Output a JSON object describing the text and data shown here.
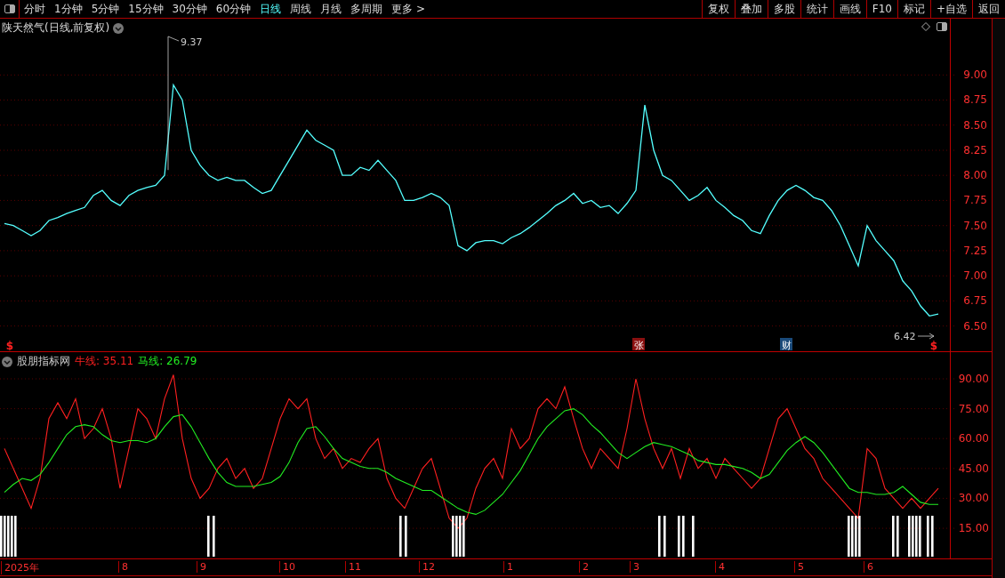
{
  "toolbar": {
    "periods": [
      {
        "label": "分时",
        "selected": false
      },
      {
        "label": "1分钟",
        "selected": false
      },
      {
        "label": "5分钟",
        "selected": false
      },
      {
        "label": "15分钟",
        "selected": false
      },
      {
        "label": "30分钟",
        "selected": false
      },
      {
        "label": "60分钟",
        "selected": false
      },
      {
        "label": "日线",
        "selected": true
      },
      {
        "label": "周线",
        "selected": false
      },
      {
        "label": "月线",
        "selected": false
      },
      {
        "label": "多周期",
        "selected": false
      },
      {
        "label": "更多 >",
        "selected": false
      }
    ],
    "actions": [
      "复权",
      "叠加",
      "多股",
      "统计",
      "画线",
      "F10",
      "标记",
      "+自选",
      "返回"
    ]
  },
  "price_panel": {
    "title": "陕天然气(日线,前复权)",
    "chart_data": {
      "type": "line",
      "grid": true,
      "categories": [
        null,
        null,
        null,
        null,
        null,
        null,
        null,
        null,
        null,
        null,
        null,
        null,
        null,
        null,
        null,
        null,
        null,
        null,
        null,
        null,
        null,
        null,
        null,
        null,
        null,
        null,
        null,
        null,
        null,
        null,
        null,
        null,
        null,
        null,
        null,
        null,
        null,
        null,
        null,
        null,
        null,
        null,
        null,
        null,
        null,
        null,
        null,
        null,
        null,
        null,
        null,
        null,
        null,
        null,
        null,
        null,
        null,
        null,
        null,
        null,
        null,
        null,
        null,
        null,
        null,
        null,
        null,
        null,
        null,
        null,
        null,
        null,
        null,
        null,
        null,
        null,
        null,
        null,
        null,
        null,
        null,
        null,
        null,
        null,
        null,
        null,
        null,
        null,
        null,
        null,
        null,
        null,
        null,
        null,
        null,
        null,
        null,
        null,
        null,
        null,
        null,
        null,
        null,
        null,
        null,
        null
      ],
      "ylim": [
        6.24,
        9.56
      ],
      "yticks": [
        {
          "value": 6.5,
          "label": "6.50"
        },
        {
          "value": 6.75,
          "label": "6.75"
        },
        {
          "value": 7,
          "label": "7.00"
        },
        {
          "value": 7.25,
          "label": "7.25"
        },
        {
          "value": 7.5,
          "label": "7.50"
        },
        {
          "value": 7.75,
          "label": "7.75"
        },
        {
          "value": 8,
          "label": "8.00"
        },
        {
          "value": 8.25,
          "label": "8.25"
        },
        {
          "value": 8.5,
          "label": "8.50"
        },
        {
          "value": 8.75,
          "label": "8.75"
        },
        {
          "value": 9,
          "label": "9.00"
        }
      ],
      "series": [
        {
          "color": "#54ffff",
          "values": [
            7.52,
            7.5,
            7.45,
            7.4,
            7.45,
            7.55,
            7.58,
            7.62,
            7.65,
            7.68,
            7.8,
            7.85,
            7.75,
            7.7,
            7.8,
            7.85,
            7.88,
            7.9,
            8.0,
            8.9,
            8.75,
            8.25,
            8.1,
            8.0,
            7.95,
            7.98,
            7.95,
            7.95,
            7.88,
            7.82,
            7.85,
            8.0,
            8.15,
            8.3,
            8.45,
            8.35,
            8.3,
            8.25,
            8.0,
            8.0,
            8.08,
            8.05,
            8.15,
            8.05,
            7.95,
            7.75,
            7.75,
            7.78,
            7.82,
            7.78,
            7.7,
            7.3,
            7.25,
            7.33,
            7.35,
            7.35,
            7.32,
            7.38,
            7.42,
            7.48,
            7.55,
            7.62,
            7.7,
            7.75,
            7.82,
            7.72,
            7.75,
            7.68,
            7.7,
            7.62,
            7.72,
            7.85,
            8.7,
            8.25,
            8.0,
            7.95,
            7.85,
            7.75,
            7.8,
            7.88,
            7.75,
            7.68,
            7.6,
            7.55,
            7.45,
            7.42,
            7.6,
            7.75,
            7.85,
            7.9,
            7.85,
            7.78,
            7.75,
            7.65,
            7.5,
            7.3,
            7.1,
            7.5,
            7.35,
            7.25,
            7.15,
            6.95,
            6.85,
            6.7,
            6.6,
            6.62
          ]
        }
      ]
    },
    "markers": [
      {
        "text": "9.37",
        "kind": "high"
      },
      {
        "text": "6.42",
        "kind": "low"
      },
      {
        "text": "$",
        "kind": "dollar"
      },
      {
        "text": "张",
        "kind": "red-tag"
      },
      {
        "text": "财",
        "kind": "blue-tag"
      },
      {
        "text": "$",
        "kind": "dollar"
      }
    ]
  },
  "indicator_panel": {
    "name": "股朋指标网",
    "readings": [
      ": 35.11",
      ": 26.79"
    ],
    "chart_data": {
      "type": "line",
      "grid": true,
      "categories": [
        null,
        null,
        null,
        null,
        null,
        null,
        null,
        null,
        null,
        null,
        null,
        null,
        null,
        null,
        null,
        null,
        null,
        null,
        null,
        null,
        null,
        null,
        null,
        null,
        null,
        null,
        null,
        null,
        null,
        null,
        null,
        null,
        null,
        null,
        null,
        null,
        null,
        null,
        null,
        null,
        null,
        null,
        null,
        null,
        null,
        null,
        null,
        null,
        null,
        null,
        null,
        null,
        null,
        null,
        null,
        null,
        null,
        null,
        null,
        null,
        null,
        null,
        null,
        null,
        null,
        null,
        null,
        null,
        null,
        null,
        null,
        null,
        null,
        null,
        null,
        null,
        null,
        null,
        null,
        null,
        null,
        null,
        null,
        null,
        null,
        null,
        null,
        null,
        null,
        null,
        null,
        null,
        null,
        null,
        null,
        null,
        null,
        null,
        null,
        null,
        null,
        null,
        null,
        null,
        null,
        null
      ],
      "ylim": [
        -0.6,
        103.4
      ],
      "yticks": [
        {
          "value": 15,
          "label": "15.00"
        },
        {
          "value": 30,
          "label": "30.00"
        },
        {
          "value": 45,
          "label": "45.00"
        },
        {
          "value": 60,
          "label": "60.00"
        },
        {
          "value": 75,
          "label": "75.00"
        },
        {
          "value": 90,
          "label": "90.00"
        }
      ],
      "series": [
        {
          "name": "牛线",
          "color": "#ff2020",
          "values": [
            55,
            45,
            35,
            25,
            40,
            70,
            78,
            70,
            80,
            60,
            65,
            75,
            60,
            35,
            55,
            75,
            70,
            60,
            80,
            92,
            60,
            40,
            30,
            35,
            45,
            50,
            40,
            45,
            35,
            40,
            55,
            70,
            80,
            75,
            80,
            60,
            50,
            55,
            45,
            50,
            48,
            55,
            60,
            40,
            30,
            25,
            35,
            45,
            50,
            35,
            20,
            15,
            20,
            35,
            45,
            50,
            40,
            65,
            55,
            60,
            75,
            80,
            75,
            86,
            70,
            55,
            45,
            55,
            50,
            45,
            65,
            90,
            70,
            55,
            45,
            55,
            40,
            55,
            45,
            50,
            40,
            50,
            45,
            40,
            35,
            40,
            55,
            70,
            75,
            65,
            55,
            50,
            40,
            35,
            30,
            25,
            20,
            55,
            50,
            35,
            30,
            25,
            30,
            25,
            30,
            35
          ]
        },
        {
          "name": "马线",
          "color": "#22ee22",
          "values": [
            33,
            37,
            40,
            39,
            42,
            48,
            55,
            62,
            66,
            67,
            66,
            62,
            59,
            58,
            59,
            59,
            58,
            60,
            66,
            71,
            72,
            66,
            58,
            50,
            43,
            38,
            36,
            36,
            36,
            37,
            38,
            41,
            48,
            58,
            65,
            66,
            61,
            55,
            50,
            48,
            46,
            45,
            45,
            43,
            40,
            38,
            36,
            34,
            34,
            31,
            28,
            25,
            23,
            22,
            24,
            28,
            32,
            38,
            44,
            52,
            60,
            66,
            70,
            74,
            75,
            72,
            67,
            63,
            58,
            53,
            50,
            53,
            56,
            58,
            57,
            56,
            54,
            52,
            49,
            48,
            47,
            47,
            46,
            45,
            43,
            40,
            42,
            48,
            54,
            58,
            61,
            58,
            53,
            47,
            41,
            35,
            33,
            33,
            32,
            32,
            33,
            36,
            32,
            28,
            27,
            27
          ]
        }
      ]
    }
  },
  "date_axis": [
    "2025年",
    "8",
    "9",
    "10",
    "11",
    "12",
    "1",
    "2",
    "3",
    "4",
    "5",
    "6"
  ]
}
